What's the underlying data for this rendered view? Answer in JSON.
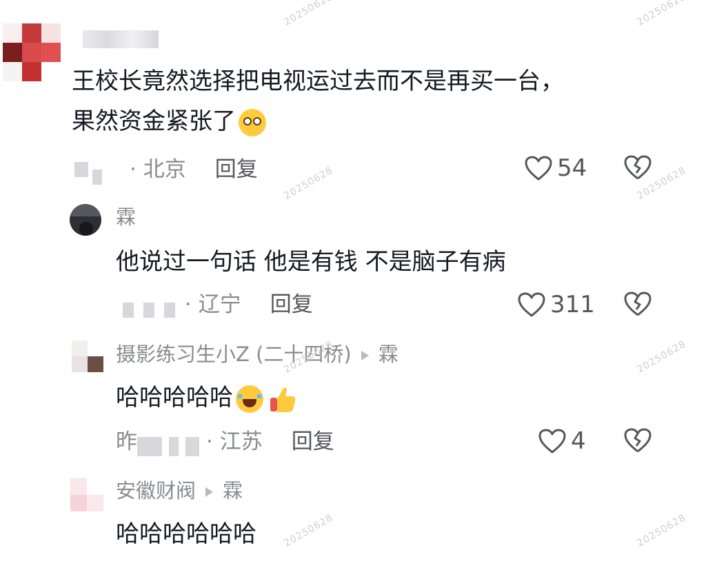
{
  "watermark": "20250628",
  "comments": [
    {
      "username": "",
      "text_lines": [
        "王校长竟然选择把电视运过去而不是再买一台，",
        "果然资金紧张了"
      ],
      "emoji": "face-with-rolling-eyes",
      "location": "· 北京",
      "reply_label": "回复",
      "likes": "54"
    },
    {
      "username": "霖",
      "text": "他说过一句话 他是有钱 不是脑子有病",
      "location": "· 辽宁",
      "reply_label": "回复",
      "likes": "311"
    },
    {
      "username": "摄影练习生小Z (二十四桥)",
      "reply_to": "霖",
      "text": "哈哈哈哈哈",
      "emoji": [
        "loudly-crying-laughing-face",
        "thumbs-up"
      ],
      "time_prefix": "昨",
      "location": "· 江苏",
      "reply_label": "回复",
      "likes": "4"
    },
    {
      "username": "安徽财阀",
      "reply_to": "霖",
      "text": "哈哈哈哈哈哈"
    }
  ]
}
